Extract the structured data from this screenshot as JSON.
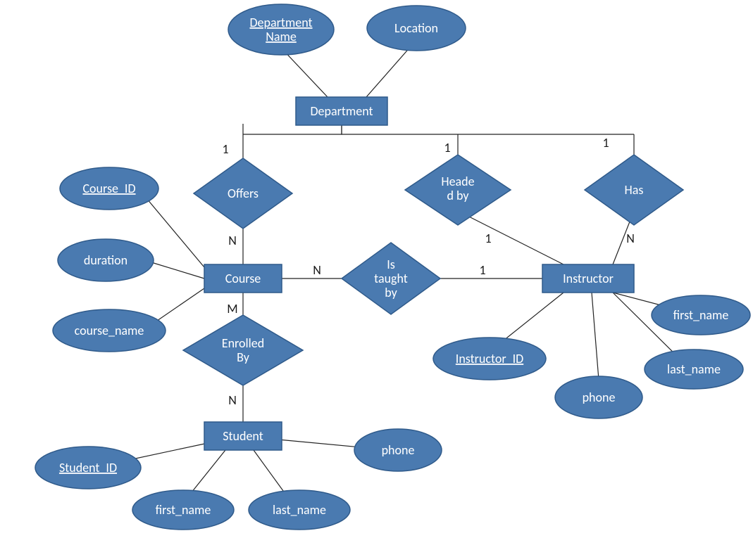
{
  "entities": {
    "department": "Department",
    "course": "Course",
    "instructor": "Instructor",
    "student": "Student"
  },
  "attributes": {
    "dept_name_l1": "Department",
    "dept_name_l2": "Name",
    "location": "Location",
    "course_id": "Course_ID",
    "duration": "duration",
    "course_name": "course_name",
    "instructor_id": "Instructor_ID",
    "i_first_name": "first_name",
    "i_last_name": "last_name",
    "i_phone": "phone",
    "student_id": "Student_ID",
    "s_first_name": "first_name",
    "s_last_name": "last_name",
    "s_phone": "phone"
  },
  "relationships": {
    "offers": "Offers",
    "headed_l1": "Heade",
    "headed_l2": "d by",
    "has": "Has",
    "taught_l1": "Is",
    "taught_l2": "taught",
    "taught_l3": "by",
    "enrolled_l1": "Enrolled",
    "enrolled_l2": "By"
  },
  "card": {
    "offers_dept": "1",
    "offers_course": "N",
    "headed_dept": "1",
    "headed_instr": "1",
    "has_dept": "1",
    "has_instr": "N",
    "taught_course": "N",
    "taught_instr": "1",
    "enrolled_course": "M",
    "enrolled_student": "N"
  },
  "colors": {
    "shape_fill": "#4a7ab0",
    "shape_stroke": "#2f5a8a",
    "text": "#ffffff",
    "line": "#222222"
  }
}
